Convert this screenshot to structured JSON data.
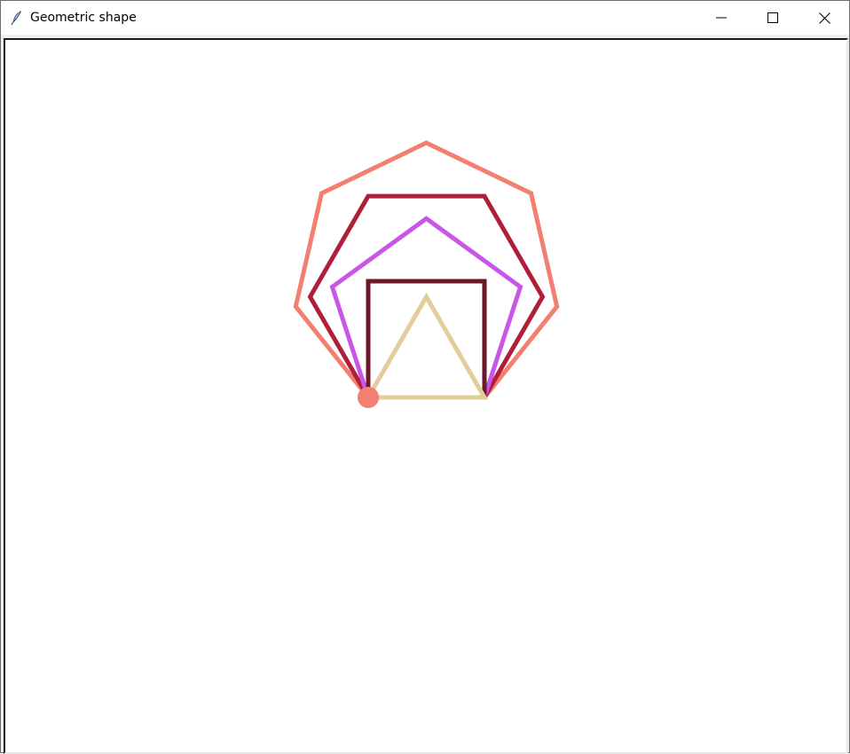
{
  "window": {
    "title": "Geometric shape",
    "app_icon": "feather-icon",
    "controls": {
      "minimize_icon": "minimize-icon",
      "maximize_icon": "maximize-icon",
      "close_icon": "close-icon"
    }
  },
  "canvas": {
    "background": "#ffffff",
    "shapes": [
      {
        "name": "triangle",
        "sides": 3,
        "color": "#e3cd9b"
      },
      {
        "name": "square",
        "sides": 4,
        "color": "#6b1828"
      },
      {
        "name": "pentagon",
        "sides": 5,
        "color": "#c857e8"
      },
      {
        "name": "hexagon",
        "sides": 6,
        "color": "#b01f3a"
      },
      {
        "name": "heptagon",
        "sides": 7,
        "color": "#f27f6f"
      }
    ],
    "turtle_color": "#f27f6f"
  }
}
